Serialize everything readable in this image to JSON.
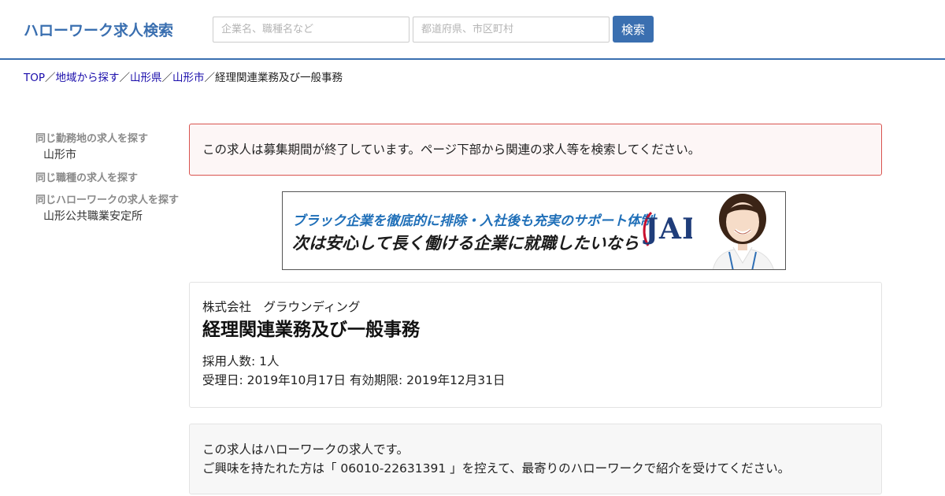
{
  "header": {
    "logo": "ハローワーク求人検索",
    "keyword_placeholder": "企業名、職種名など",
    "location_placeholder": "都道府県、市区町村",
    "search_button": "検索"
  },
  "breadcrumb": {
    "items": [
      "TOP",
      "地域から探す",
      "山形県",
      "山形市"
    ],
    "current": "経理関連業務及び一般事務",
    "separator": "／"
  },
  "sidebar": {
    "groups": [
      {
        "heading": "同じ勤務地の求人を探す",
        "link": "山形市"
      },
      {
        "heading": "同じ職種の求人を探す",
        "link": ""
      },
      {
        "heading": "同じハローワークの求人を探す",
        "link": "山形公共職業安定所"
      }
    ]
  },
  "alert": {
    "text": "この求人は募集期間が終了しています。ページ下部から関連の求人等を検索してください。"
  },
  "banner": {
    "line1": "ブラック企業を徹底的に排除・入社後も充実のサポート体制",
    "line2": "次は安心して長く働ける企業に就職したいなら",
    "logo": "JAIC",
    "colors": {
      "line1": "#1f6fb8",
      "logo": "#1f3d7a",
      "swoosh": "#c8102e"
    }
  },
  "job": {
    "company": "株式会社　グラウンディング",
    "title": "経理関連業務及び一般事務",
    "hires": "採用人数: 1人",
    "dates": "受理日: 2019年10月17日 有効期限: 2019年12月31日"
  },
  "notice": {
    "line1": "この求人はハローワークの求人です。",
    "line2": "ご興味を持たれた方は「 06010-22631391 」を控えて、最寄りのハローワークで紹介を受けてください。"
  },
  "colors": {
    "accent": "#3a6fb0",
    "link": "#1a0dab",
    "alert_border": "#d9534f",
    "alert_bg": "#fdf6f6"
  }
}
